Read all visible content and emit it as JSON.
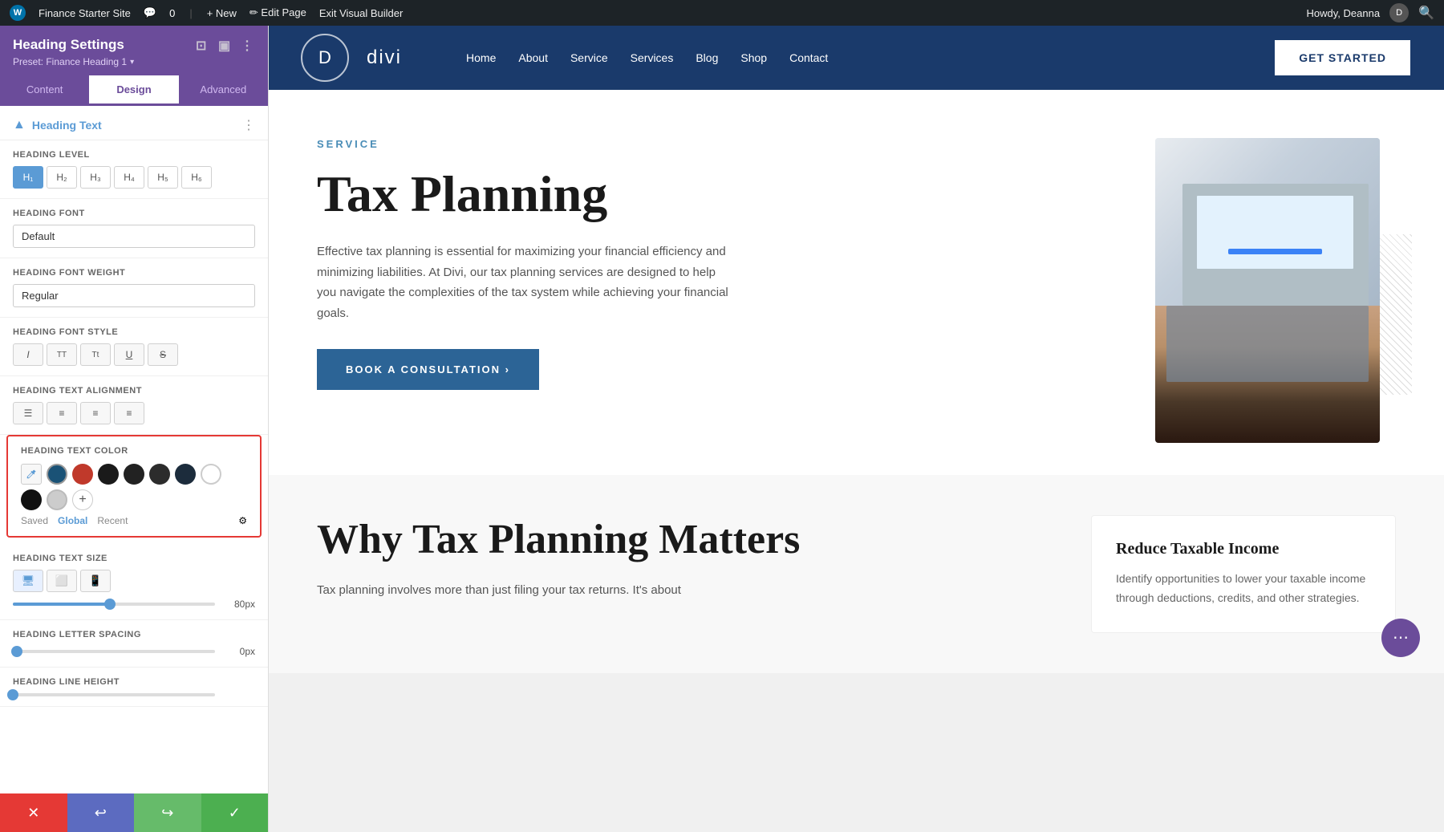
{
  "adminBar": {
    "wpLabel": "W",
    "siteName": "Finance Starter Site",
    "commentsIcon": "💬",
    "commentsCount": "0",
    "newLabel": "+ New",
    "editPageLabel": "✏ Edit Page",
    "exitBuilder": "Exit Visual Builder",
    "howdy": "Howdy, Deanna",
    "avatarText": "D"
  },
  "panel": {
    "title": "Heading Settings",
    "preset": "Preset: Finance Heading 1",
    "tabs": [
      {
        "id": "content",
        "label": "Content"
      },
      {
        "id": "design",
        "label": "Design"
      },
      {
        "id": "advanced",
        "label": "Advanced"
      }
    ],
    "activeTab": "design",
    "section": {
      "title": "Heading Text",
      "settings": {
        "headingLevel": {
          "label": "Heading Level",
          "levels": [
            "H1",
            "H2",
            "H3",
            "H4",
            "H5",
            "H6"
          ],
          "active": "H1"
        },
        "headingFont": {
          "label": "Heading Font",
          "value": "Default"
        },
        "headingFontWeight": {
          "label": "Heading Font Weight",
          "value": "Regular"
        },
        "headingFontStyle": {
          "label": "Heading Font Style",
          "buttons": [
            "I",
            "TT",
            "Tt",
            "U",
            "S"
          ]
        },
        "headingTextAlignment": {
          "label": "Heading Text Alignment",
          "buttons": [
            "≡",
            "≡",
            "≡",
            "≡"
          ]
        },
        "headingTextColor": {
          "label": "Heading Text Color",
          "swatches": [
            {
              "color": "#1a5276",
              "name": "dark-blue"
            },
            {
              "color": "#c0392b",
              "name": "red"
            },
            {
              "color": "#1a1a1a",
              "name": "dark-1"
            },
            {
              "color": "#222",
              "name": "dark-2"
            },
            {
              "color": "#2c2c2c",
              "name": "dark-3"
            },
            {
              "color": "#1c2c3c",
              "name": "navy"
            },
            {
              "color": "#fff",
              "name": "white"
            },
            {
              "color": "#111",
              "name": "black-1"
            },
            {
              "color": "#ccc",
              "name": "light-gray"
            }
          ],
          "colorTabs": [
            "Saved",
            "Global",
            "Recent"
          ],
          "activeColorTab": "Global"
        },
        "headingTextSize": {
          "label": "Heading Text Size",
          "value": "80px",
          "sliderPercent": 48
        },
        "headingLetterSpacing": {
          "label": "Heading Letter Spacing",
          "value": "0px",
          "sliderPercent": 2
        },
        "headingLineHeight": {
          "label": "Heading Line Height"
        }
      }
    }
  },
  "actions": {
    "cancel": "✕",
    "undo": "↩",
    "redo": "↪",
    "save": "✓"
  },
  "site": {
    "logo": "D",
    "brandName": "divi",
    "navLinks": [
      "Home",
      "About",
      "Service",
      "Services",
      "Blog",
      "Shop",
      "Contact"
    ],
    "ctaButton": "GET STARTED"
  },
  "heroSection": {
    "label": "SERVICE",
    "title": "Tax Planning",
    "description": "Effective tax planning is essential for maximizing your financial efficiency and minimizing liabilities. At Divi, our tax planning services are designed to help you navigate the complexities of the tax system while achieving your financial goals.",
    "bookButton": "BOOK A CONSULTATION ›"
  },
  "secondSection": {
    "title": "Why Tax Planning Matters",
    "description": "Tax planning involves more than just filing your tax returns. It's about",
    "card": {
      "title": "Reduce Taxable Income",
      "description": "Identify opportunities to lower your taxable income through deductions, credits, and other strategies."
    }
  }
}
